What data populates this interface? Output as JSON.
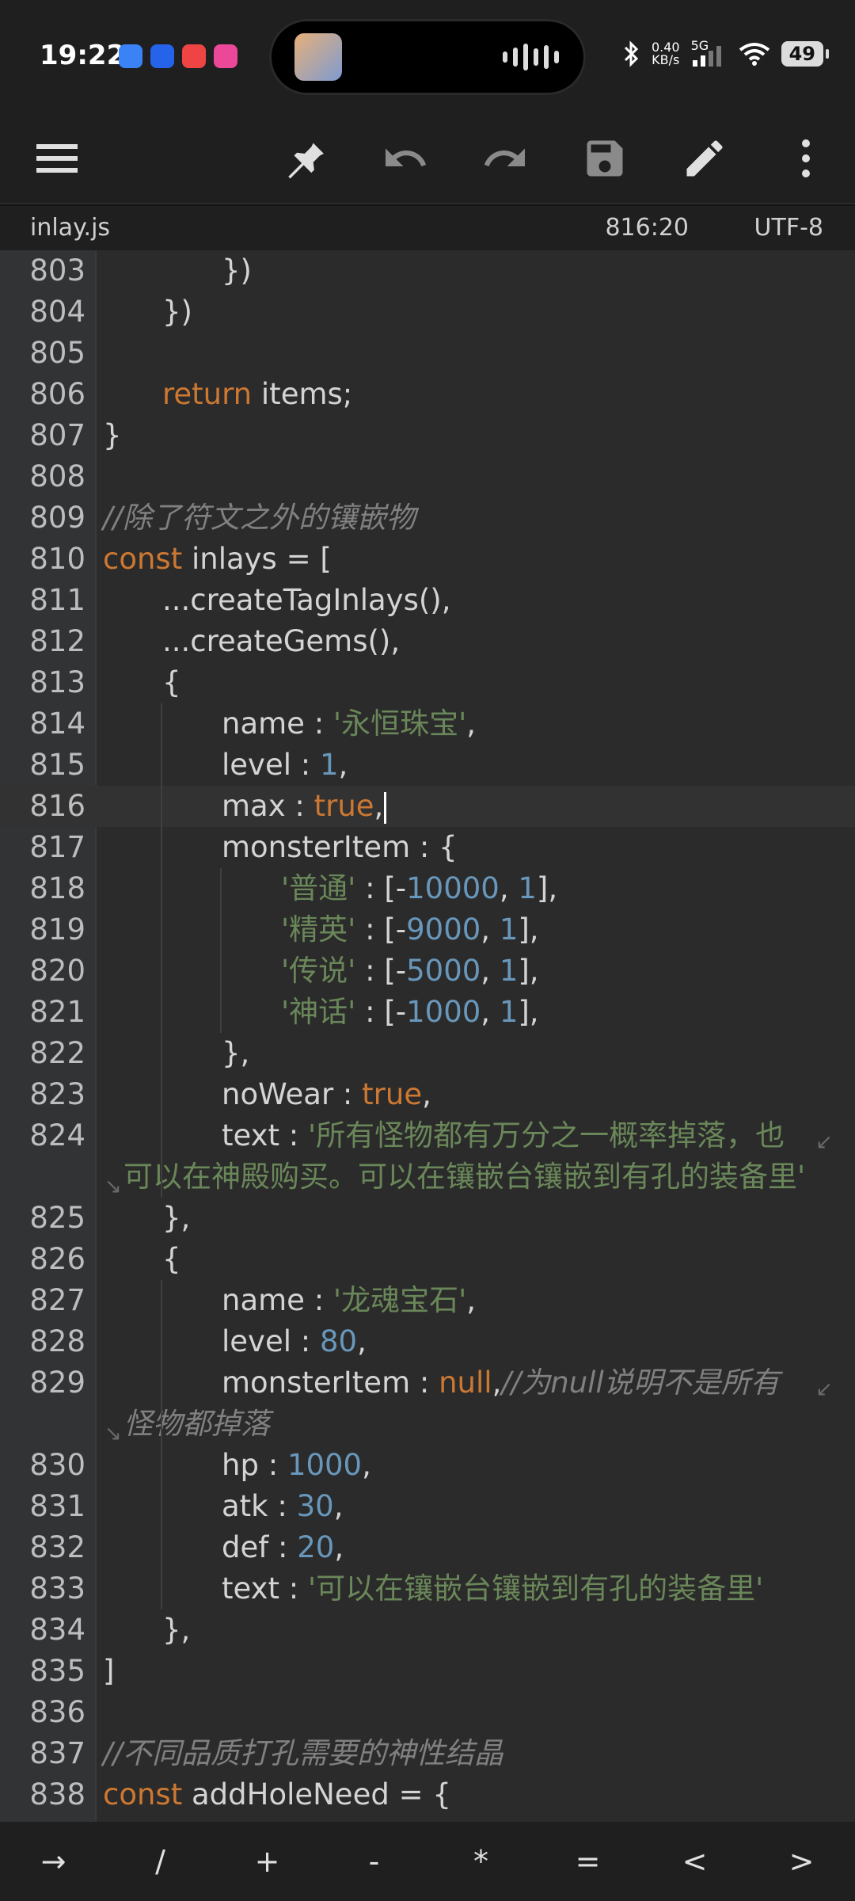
{
  "status": {
    "time": "19:22",
    "speed_value": "0.40",
    "speed_unit": "KB/s",
    "network": "5G",
    "battery": "49",
    "app_colors": [
      "#3b82f6",
      "#2563eb",
      "#ef4444",
      "#ec4899"
    ]
  },
  "toolbar": {
    "buttons": [
      "menu-icon",
      "pin-icon",
      "undo-icon",
      "redo-icon",
      "save-icon",
      "edit-icon",
      "more-vertical-icon"
    ]
  },
  "file": {
    "name": "inlay.js",
    "cursor_position": "816:20",
    "encoding": "UTF-8"
  },
  "editor": {
    "current_line": "816",
    "lines": [
      {
        "n": "803",
        "indent": 2,
        "tokens": [
          {
            "t": "})",
            "c": "p"
          }
        ]
      },
      {
        "n": "804",
        "indent": 1,
        "tokens": [
          {
            "t": "})",
            "c": "p"
          }
        ]
      },
      {
        "n": "805",
        "indent": 0,
        "tokens": []
      },
      {
        "n": "806",
        "indent": 1,
        "tokens": [
          {
            "t": "return",
            "c": "kw"
          },
          {
            "t": " items;",
            "c": "p"
          }
        ]
      },
      {
        "n": "807",
        "indent": 0,
        "tokens": [
          {
            "t": "}",
            "c": "p"
          }
        ]
      },
      {
        "n": "808",
        "indent": 0,
        "tokens": []
      },
      {
        "n": "809",
        "indent": 0,
        "tokens": [
          {
            "t": "//除了符文之外的镶嵌物",
            "c": "cm"
          }
        ]
      },
      {
        "n": "810",
        "indent": 0,
        "tokens": [
          {
            "t": "const",
            "c": "kw"
          },
          {
            "t": " inlays = [",
            "c": "p"
          }
        ]
      },
      {
        "n": "811",
        "indent": 1,
        "tokens": [
          {
            "t": "...createTagInlays(),",
            "c": "p"
          }
        ]
      },
      {
        "n": "812",
        "indent": 1,
        "tokens": [
          {
            "t": "...createGems(),",
            "c": "p"
          }
        ]
      },
      {
        "n": "813",
        "indent": 1,
        "tokens": [
          {
            "t": "{",
            "c": "p"
          }
        ]
      },
      {
        "n": "814",
        "indent": 2,
        "tokens": [
          {
            "t": "name : ",
            "c": "p"
          },
          {
            "t": "'永恒珠宝'",
            "c": "str"
          },
          {
            "t": ",",
            "c": "p"
          }
        ]
      },
      {
        "n": "815",
        "indent": 2,
        "tokens": [
          {
            "t": "level : ",
            "c": "p"
          },
          {
            "t": "1",
            "c": "num"
          },
          {
            "t": ",",
            "c": "p"
          }
        ]
      },
      {
        "n": "816",
        "indent": 2,
        "tokens": [
          {
            "t": "max : ",
            "c": "p"
          },
          {
            "t": "true",
            "c": "kw"
          },
          {
            "t": ",",
            "c": "p"
          }
        ]
      },
      {
        "n": "817",
        "indent": 2,
        "tokens": [
          {
            "t": "monsterItem : {",
            "c": "p"
          }
        ]
      },
      {
        "n": "818",
        "indent": 3,
        "tokens": [
          {
            "t": "'普通'",
            "c": "str"
          },
          {
            "t": " : [-",
            "c": "p"
          },
          {
            "t": "10000",
            "c": "num"
          },
          {
            "t": ", ",
            "c": "p"
          },
          {
            "t": "1",
            "c": "num"
          },
          {
            "t": "],",
            "c": "p"
          }
        ]
      },
      {
        "n": "819",
        "indent": 3,
        "tokens": [
          {
            "t": "'精英'",
            "c": "str"
          },
          {
            "t": " : [-",
            "c": "p"
          },
          {
            "t": "9000",
            "c": "num"
          },
          {
            "t": ", ",
            "c": "p"
          },
          {
            "t": "1",
            "c": "num"
          },
          {
            "t": "],",
            "c": "p"
          }
        ]
      },
      {
        "n": "820",
        "indent": 3,
        "tokens": [
          {
            "t": "'传说'",
            "c": "str"
          },
          {
            "t": " : [-",
            "c": "p"
          },
          {
            "t": "5000",
            "c": "num"
          },
          {
            "t": ", ",
            "c": "p"
          },
          {
            "t": "1",
            "c": "num"
          },
          {
            "t": "],",
            "c": "p"
          }
        ]
      },
      {
        "n": "821",
        "indent": 3,
        "tokens": [
          {
            "t": "'神话'",
            "c": "str"
          },
          {
            "t": " : [-",
            "c": "p"
          },
          {
            "t": "1000",
            "c": "num"
          },
          {
            "t": ", ",
            "c": "p"
          },
          {
            "t": "1",
            "c": "num"
          },
          {
            "t": "],",
            "c": "p"
          }
        ]
      },
      {
        "n": "822",
        "indent": 2,
        "tokens": [
          {
            "t": "},",
            "c": "p"
          }
        ]
      },
      {
        "n": "823",
        "indent": 2,
        "tokens": [
          {
            "t": "noWear : ",
            "c": "p"
          },
          {
            "t": "true",
            "c": "kw"
          },
          {
            "t": ",",
            "c": "p"
          }
        ]
      },
      {
        "n": "824",
        "indent": 2,
        "wrap": true,
        "tokens": [
          {
            "t": "text : ",
            "c": "p"
          },
          {
            "t": "'所有怪物都有万分之一概率掉落，也",
            "c": "str"
          }
        ]
      },
      {
        "n": "",
        "indent": 0,
        "cont": true,
        "tokens": [
          {
            "t": "可以在神殿购买。可以在镶嵌台镶嵌到有孔的装备里'",
            "c": "str"
          }
        ]
      },
      {
        "n": "825",
        "indent": 1,
        "tokens": [
          {
            "t": "},",
            "c": "p"
          }
        ]
      },
      {
        "n": "826",
        "indent": 1,
        "tokens": [
          {
            "t": "{",
            "c": "p"
          }
        ]
      },
      {
        "n": "827",
        "indent": 2,
        "tokens": [
          {
            "t": "name : ",
            "c": "p"
          },
          {
            "t": "'龙魂宝石'",
            "c": "str"
          },
          {
            "t": ",",
            "c": "p"
          }
        ]
      },
      {
        "n": "828",
        "indent": 2,
        "tokens": [
          {
            "t": "level : ",
            "c": "p"
          },
          {
            "t": "80",
            "c": "num"
          },
          {
            "t": ",",
            "c": "p"
          }
        ]
      },
      {
        "n": "829",
        "indent": 2,
        "wrap": true,
        "tokens": [
          {
            "t": "monsterItem : ",
            "c": "p"
          },
          {
            "t": "null",
            "c": "kw"
          },
          {
            "t": ",",
            "c": "p"
          },
          {
            "t": "//为null说明不是所有",
            "c": "cm"
          }
        ]
      },
      {
        "n": "",
        "indent": 0,
        "cont": true,
        "tokens": [
          {
            "t": "怪物都掉落",
            "c": "cm"
          }
        ]
      },
      {
        "n": "830",
        "indent": 2,
        "tokens": [
          {
            "t": "hp : ",
            "c": "p"
          },
          {
            "t": "1000",
            "c": "num"
          },
          {
            "t": ",",
            "c": "p"
          }
        ]
      },
      {
        "n": "831",
        "indent": 2,
        "tokens": [
          {
            "t": "atk : ",
            "c": "p"
          },
          {
            "t": "30",
            "c": "num"
          },
          {
            "t": ",",
            "c": "p"
          }
        ]
      },
      {
        "n": "832",
        "indent": 2,
        "tokens": [
          {
            "t": "def : ",
            "c": "p"
          },
          {
            "t": "20",
            "c": "num"
          },
          {
            "t": ",",
            "c": "p"
          }
        ]
      },
      {
        "n": "833",
        "indent": 2,
        "tokens": [
          {
            "t": "text : ",
            "c": "p"
          },
          {
            "t": "'可以在镶嵌台镶嵌到有孔的装备里'",
            "c": "str"
          }
        ]
      },
      {
        "n": "834",
        "indent": 1,
        "tokens": [
          {
            "t": "},",
            "c": "p"
          }
        ]
      },
      {
        "n": "835",
        "indent": 0,
        "tokens": [
          {
            "t": "]",
            "c": "p"
          }
        ]
      },
      {
        "n": "836",
        "indent": 0,
        "tokens": []
      },
      {
        "n": "837",
        "indent": 0,
        "tokens": [
          {
            "t": "//不同品质打孔需要的神性结晶",
            "c": "cm"
          }
        ]
      },
      {
        "n": "838",
        "indent": 0,
        "tokens": [
          {
            "t": "const",
            "c": "kw"
          },
          {
            "t": " addHoleNeed = {",
            "c": "p"
          }
        ]
      }
    ]
  },
  "keybar": {
    "keys": [
      "→",
      "/",
      "+",
      "-",
      "*",
      "=",
      "<",
      ">"
    ]
  }
}
